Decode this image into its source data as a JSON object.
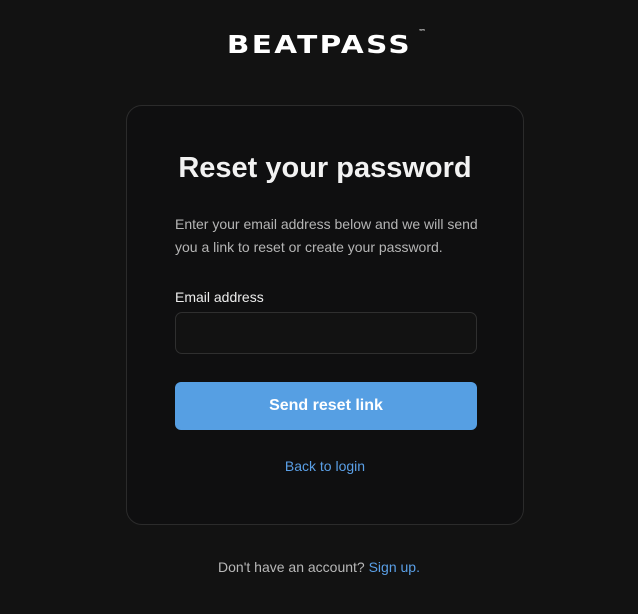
{
  "brand": {
    "logo_text": "BEATPASS",
    "trademark": "™"
  },
  "reset_form": {
    "title": "Reset your password",
    "description": "Enter your email address below and we will send you a link to reset or create your password.",
    "email_label": "Email address",
    "email_value": "",
    "submit_label": "Send reset link",
    "back_link_label": "Back to login"
  },
  "footer": {
    "prompt_text": "Don't have an account?",
    "signup_label": "Sign up."
  },
  "colors": {
    "background": "#121212",
    "card_background": "#0f0f10",
    "accent": "#569fe3",
    "link": "#5a9fe6"
  }
}
